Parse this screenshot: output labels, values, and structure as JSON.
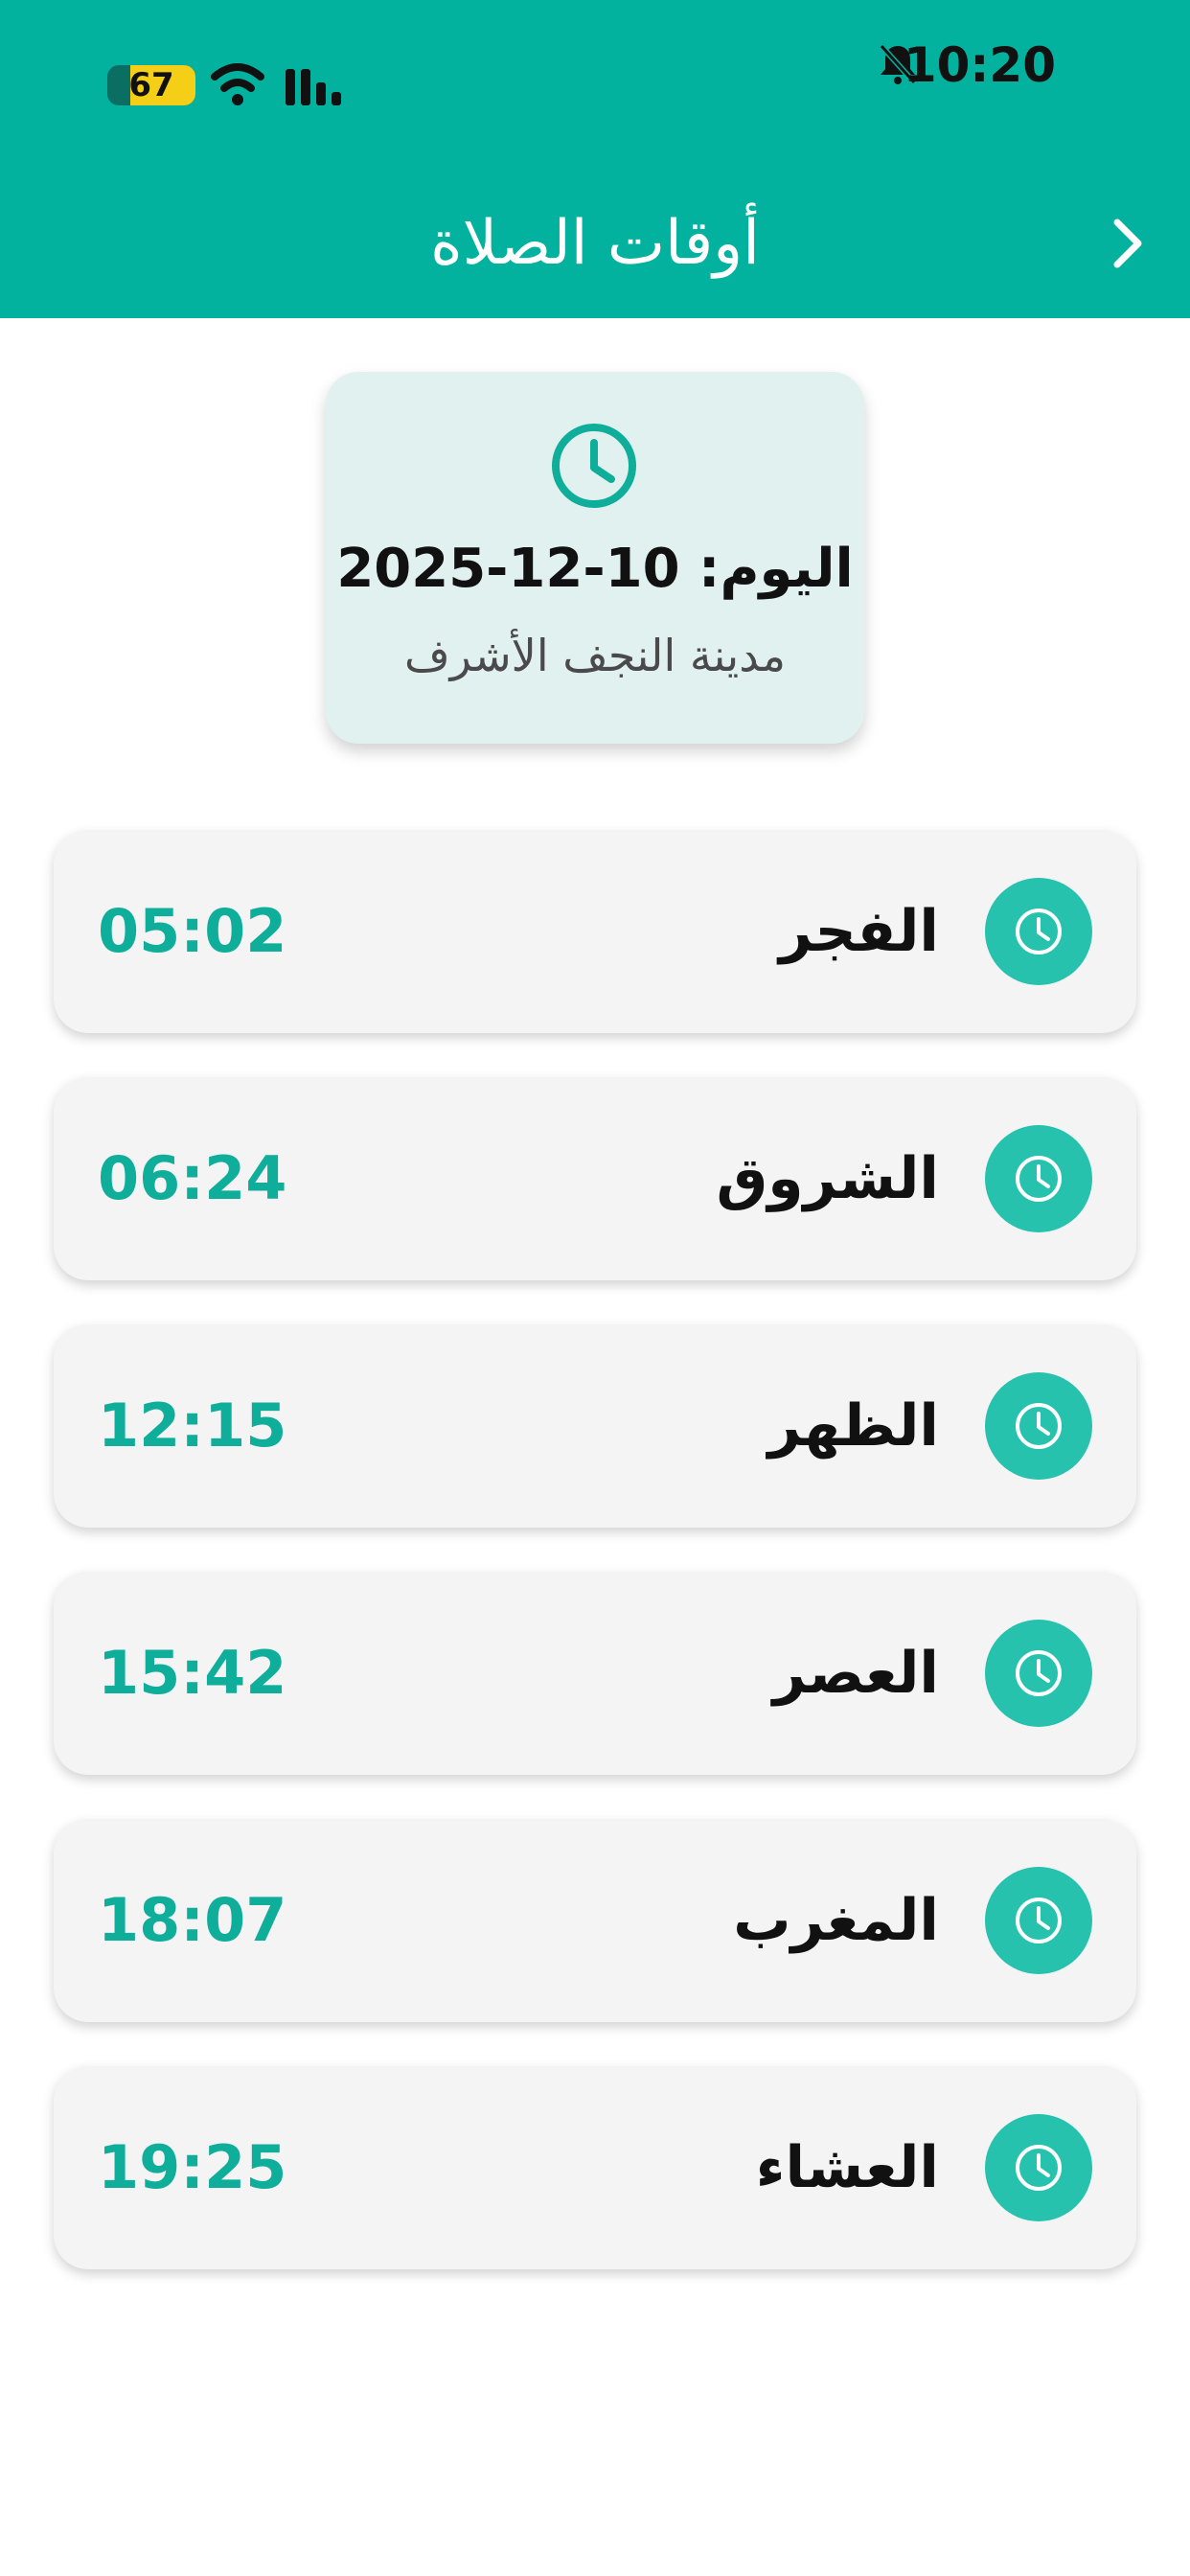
{
  "status_bar": {
    "time": "10:20",
    "battery_level": "67"
  },
  "header": {
    "title": "أوقات الصلاة"
  },
  "date_card": {
    "date_text": "اليوم: 10-12-2025",
    "city": "مدينة النجف الأشرف"
  },
  "prayers": [
    {
      "name": "الفجر",
      "time": "05:02"
    },
    {
      "name": "الشروق",
      "time": "06:24"
    },
    {
      "name": "الظهر",
      "time": "12:15"
    },
    {
      "name": "العصر",
      "time": "15:42"
    },
    {
      "name": "المغرب",
      "time": "18:07"
    },
    {
      "name": "العشاء",
      "time": "19:25"
    }
  ],
  "colors": {
    "primary": "#02B29E",
    "card_background": "#E1F1F0",
    "row_background": "#F4F4F4",
    "time_text": "#0FAE9A",
    "icon_background": "#26C2AE"
  },
  "icons": {
    "status": [
      "battery-icon",
      "wifi-icon",
      "signal-icon",
      "bell-off-icon"
    ],
    "header": "chevron-right-icon",
    "card": "clock-icon",
    "rows": "clock-icon"
  }
}
